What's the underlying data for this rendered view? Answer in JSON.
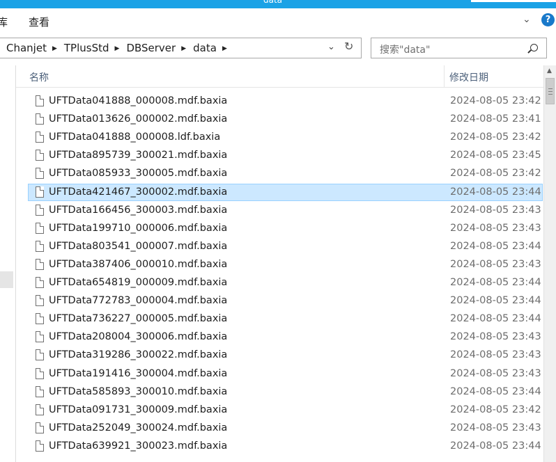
{
  "window": {
    "title": "data"
  },
  "ribbon": {
    "tabs": [
      "库",
      "查看"
    ],
    "help": "?"
  },
  "address": {
    "crumbs": [
      "Chanjet",
      "TPlusStd",
      "DBServer",
      "data"
    ]
  },
  "search": {
    "placeholder": "搜索\"data\""
  },
  "columns": {
    "name": "名称",
    "date": "修改日期"
  },
  "files": [
    {
      "name": "UFTData041888_000008.mdf.baxia",
      "date": "2024-08-05 23:42"
    },
    {
      "name": "UFTData013626_000002.mdf.baxia",
      "date": "2024-08-05 23:41"
    },
    {
      "name": "UFTData041888_000008.ldf.baxia",
      "date": "2024-08-05 23:42"
    },
    {
      "name": "UFTData895739_300021.mdf.baxia",
      "date": "2024-08-05 23:45"
    },
    {
      "name": "UFTData085933_300005.mdf.baxia",
      "date": "2024-08-05 23:42"
    },
    {
      "name": "UFTData421467_300002.mdf.baxia",
      "date": "2024-08-05 23:44",
      "selected": true
    },
    {
      "name": "UFTData166456_300003.mdf.baxia",
      "date": "2024-08-05 23:43"
    },
    {
      "name": "UFTData199710_000006.mdf.baxia",
      "date": "2024-08-05 23:43"
    },
    {
      "name": "UFTData803541_000007.mdf.baxia",
      "date": "2024-08-05 23:44"
    },
    {
      "name": "UFTData387406_000010.mdf.baxia",
      "date": "2024-08-05 23:43"
    },
    {
      "name": "UFTData654819_000009.mdf.baxia",
      "date": "2024-08-05 23:44"
    },
    {
      "name": "UFTData772783_000004.mdf.baxia",
      "date": "2024-08-05 23:44"
    },
    {
      "name": "UFTData736227_000005.mdf.baxia",
      "date": "2024-08-05 23:44"
    },
    {
      "name": "UFTData208004_300006.mdf.baxia",
      "date": "2024-08-05 23:43"
    },
    {
      "name": "UFTData319286_300022.mdf.baxia",
      "date": "2024-08-05 23:43"
    },
    {
      "name": "UFTData191416_300004.mdf.baxia",
      "date": "2024-08-05 23:43"
    },
    {
      "name": "UFTData585893_300010.mdf.baxia",
      "date": "2024-08-05 23:44"
    },
    {
      "name": "UFTData091731_300009.mdf.baxia",
      "date": "2024-08-05 23:42"
    },
    {
      "name": "UFTData252049_300024.mdf.baxia",
      "date": "2024-08-05 23:43"
    },
    {
      "name": "UFTData639921_300023.mdf.baxia",
      "date": "2024-08-05 23:44"
    }
  ],
  "colors": {
    "accent": "#1aa2e6",
    "selection": "#cce8ff",
    "selection_border": "#99d1ff"
  }
}
